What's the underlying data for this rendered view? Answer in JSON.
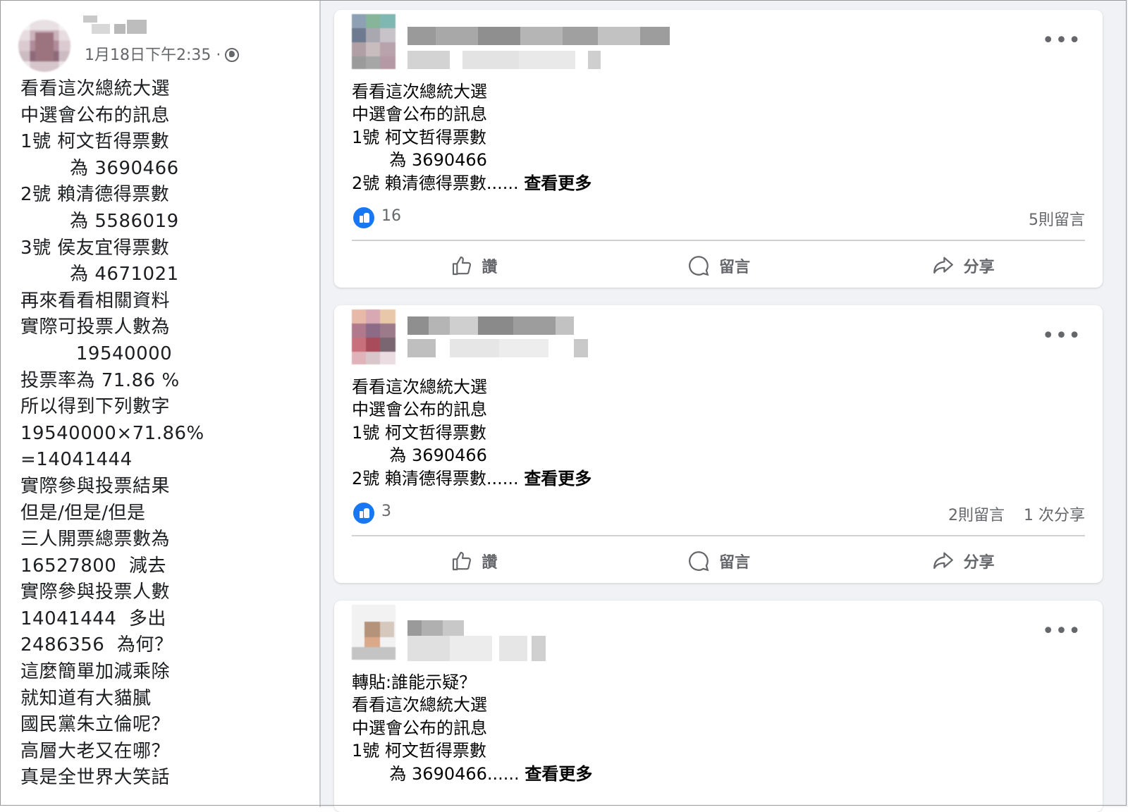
{
  "left_post": {
    "timestamp": "1月18日下午2:35 ·",
    "lines": [
      "看看這次總統大選",
      "中選會公布的訊息",
      "1號 柯文哲得票數",
      "        為 3690466",
      "2號 賴清德得票數",
      "        為 5586019",
      "3號 侯友宜得票數",
      "        為 4671021",
      "再來看看相關資料",
      "實際可投票人數為",
      "         19540000",
      "投票率為 71.86 %",
      "所以得到下列數字",
      "19540000×71.86%",
      "=14041444",
      "實際參與投票結果",
      "但是/但是/但是",
      "三人開票總票數為",
      "16527800  減去",
      "實際參與投票人數",
      "14041444  多出",
      "2486356  為何？",
      "這麼簡單加減乘除",
      "就知道有大貓膩",
      "國民黨朱立倫呢？",
      "高層大老又在哪？",
      "真是全世界大笑話"
    ]
  },
  "posts": [
    {
      "lines": [
        "看看這次總統大選",
        "中選會公布的訊息",
        "1號 柯文哲得票數",
        "       為 3690466",
        "2號 賴清德得票數......"
      ],
      "see_more": "查看更多",
      "likes": "16",
      "comments": "5則留言",
      "shares": ""
    },
    {
      "lines": [
        "看看這次總統大選",
        "中選會公布的訊息",
        "1號 柯文哲得票數",
        "       為 3690466",
        "2號 賴清德得票數......"
      ],
      "see_more": "查看更多",
      "likes": "3",
      "comments": "2則留言",
      "shares": "1 次分享"
    },
    {
      "lines": [
        "轉貼:誰能示疑？",
        "看看這次總統大選",
        "中選會公布的訊息",
        "1號 柯文哲得票數",
        "       為 3690466......"
      ],
      "see_more": "查看更多"
    }
  ],
  "actions": {
    "like": "讚",
    "comment": "留言",
    "share": "分享"
  },
  "more_glyph": "•••",
  "colors": {
    "accent": "#1877f2",
    "feed_background": "#f0f2f5",
    "secondary_text": "#65676b"
  }
}
